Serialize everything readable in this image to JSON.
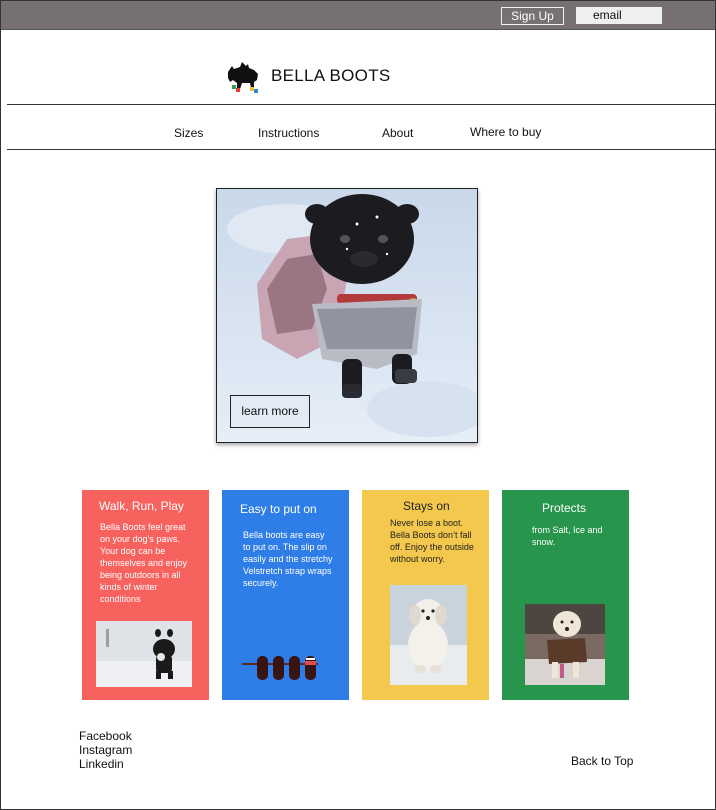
{
  "topbar": {
    "signup_label": "Sign Up",
    "email_value": "email"
  },
  "brand": {
    "name": "BELLA BOOTS",
    "logo_icon": "dog-silhouette-icon"
  },
  "nav": {
    "items": [
      "Sizes",
      "Instructions",
      "About",
      "Where to buy"
    ]
  },
  "hero": {
    "image": "pug-in-snow-photo",
    "button_label": "learn more"
  },
  "cards": [
    {
      "title": "Walk, Run, Play",
      "text": "Bella Boots feel great on your dog’s paws. Your dog can be themselves and enjoy being outdoors in all kinds of winter conditions",
      "color": "#f7625f",
      "image": "dog-running-in-snow-photo"
    },
    {
      "title": "Easy to put on",
      "text": "Bella boots are easy to put on. The slip on easily and the stretchy Velstretch strap wraps securely.",
      "color": "#2f7ee8",
      "image": "boots-row-illustration"
    },
    {
      "title": "Stays on",
      "text": "Never lose a boot. Bella Boots don’t fall off. Enjoy the outside without worry.",
      "color": "#f4c84c",
      "image": "white-dog-sitting-in-snow-photo"
    },
    {
      "title": "Protects",
      "text": "from Salt, Ice and snow.",
      "color": "#27964c",
      "image": "fluffy-dog-in-coat-photo"
    }
  ],
  "footer": {
    "links": [
      "Facebook",
      "Instagram",
      "Linkedin"
    ],
    "back_to_top": "Back to Top"
  },
  "colors": {
    "topbar": "#777171",
    "walk": "#f7625f",
    "easy": "#2f7ee8",
    "stays": "#f4c84c",
    "protects": "#27964c"
  }
}
